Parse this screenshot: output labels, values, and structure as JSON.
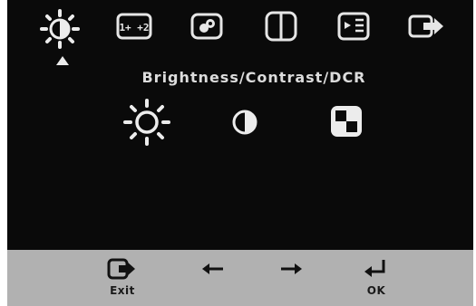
{
  "osd": {
    "title": "Brightness/Contrast/DCR",
    "top_tabs": [
      {
        "icon": "brightness-sun-icon",
        "selected": true
      },
      {
        "icon": "image-position-icon"
      },
      {
        "icon": "image-setup-icon"
      },
      {
        "icon": "image-properties-icon"
      },
      {
        "icon": "options-menu-icon"
      },
      {
        "icon": "exit-icon"
      }
    ],
    "sub_items": [
      {
        "icon": "brightness-icon"
      },
      {
        "icon": "contrast-icon"
      },
      {
        "icon": "dcr-icon"
      }
    ]
  },
  "bottom_bar": {
    "exit_label": "Exit",
    "ok_label": "OK",
    "buttons": [
      "exit-icon",
      "arrow-left-icon",
      "arrow-right-icon",
      "enter-icon"
    ]
  },
  "colors": {
    "osd_bg": "#0a0a0a",
    "icon": "#e6e6e6",
    "bar_bg": "#b1b1b1",
    "bar_icon": "#111111"
  }
}
